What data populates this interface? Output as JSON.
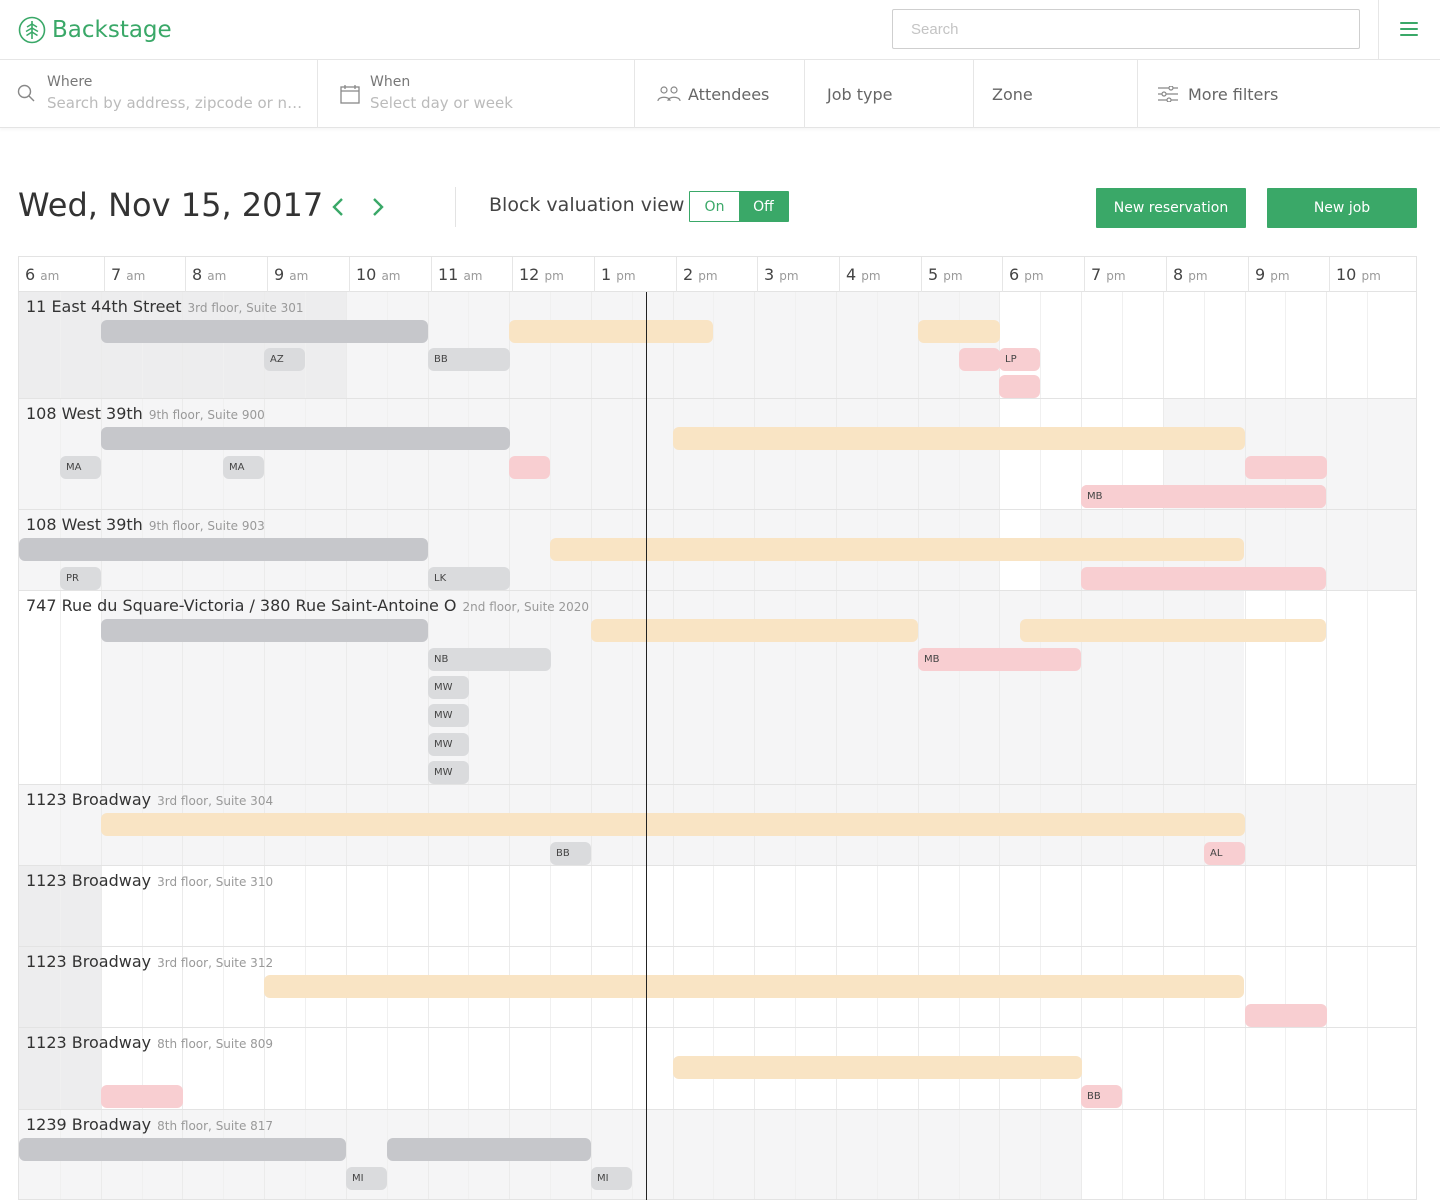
{
  "app": {
    "name": "Backstage",
    "accent": "#3aa868"
  },
  "search": {
    "placeholder": "Search"
  },
  "filters": {
    "where": {
      "label": "Where",
      "placeholder": "Search by address, zipcode or nei..."
    },
    "when": {
      "label": "When",
      "placeholder": "Select day or week"
    },
    "attendees": "Attendees",
    "job_type": "Job type",
    "zone": "Zone",
    "more": "More filters"
  },
  "header": {
    "date": "Wed, Nov 15, 2017",
    "block_valuation_label": "Block valuation view",
    "toggle_on": "On",
    "toggle_off": "Off",
    "toggle_state": "Off",
    "new_reservation": "New reservation",
    "new_job": "New job"
  },
  "calendar": {
    "hours": [
      {
        "n": "6",
        "ap": "am"
      },
      {
        "n": "7",
        "ap": "am"
      },
      {
        "n": "8",
        "ap": "am"
      },
      {
        "n": "9",
        "ap": "am"
      },
      {
        "n": "10",
        "ap": "am"
      },
      {
        "n": "11",
        "ap": "am"
      },
      {
        "n": "12",
        "ap": "pm"
      },
      {
        "n": "1",
        "ap": "pm"
      },
      {
        "n": "2",
        "ap": "pm"
      },
      {
        "n": "3",
        "ap": "pm"
      },
      {
        "n": "4",
        "ap": "pm"
      },
      {
        "n": "5",
        "ap": "pm"
      },
      {
        "n": "6",
        "ap": "pm"
      },
      {
        "n": "7",
        "ap": "pm"
      },
      {
        "n": "8",
        "ap": "pm"
      },
      {
        "n": "9",
        "ap": "pm"
      },
      {
        "n": "10",
        "ap": "pm"
      }
    ],
    "current_time": "12:45 pm",
    "rows": [
      {
        "address": "11 East 44th Street",
        "suite": "3rd floor, Suite 301"
      },
      {
        "address": "108 West 39th",
        "suite": "9th floor, Suite 900"
      },
      {
        "address": "108 West 39th",
        "suite": "9th floor, Suite 903"
      },
      {
        "address": "747 Rue du Square-Victoria / 380 Rue Saint-Antoine O",
        "suite": "2nd floor, Suite 2020"
      },
      {
        "address": "1123 Broadway",
        "suite": "3rd floor, Suite 304"
      },
      {
        "address": "1123 Broadway",
        "suite": "3rd floor, Suite 310"
      },
      {
        "address": "1123 Broadway",
        "suite": "3rd floor, Suite 312"
      },
      {
        "address": "1123 Broadway",
        "suite": "8th floor, Suite 809"
      },
      {
        "address": "1239 Broadway",
        "suite": "8th floor, Suite 817"
      }
    ],
    "tags": {
      "r0": [
        "AZ",
        "BB",
        "LP"
      ],
      "r1": [
        "MA",
        "MA",
        "MB"
      ],
      "r2": [
        "PR",
        "LK"
      ],
      "r3": [
        "NB",
        "MB",
        "MW",
        "MW",
        "MW",
        "MW"
      ],
      "r4": [
        "BB",
        "AL"
      ],
      "r7": [
        "BB"
      ],
      "r8": [
        "MI",
        "MI"
      ]
    }
  }
}
